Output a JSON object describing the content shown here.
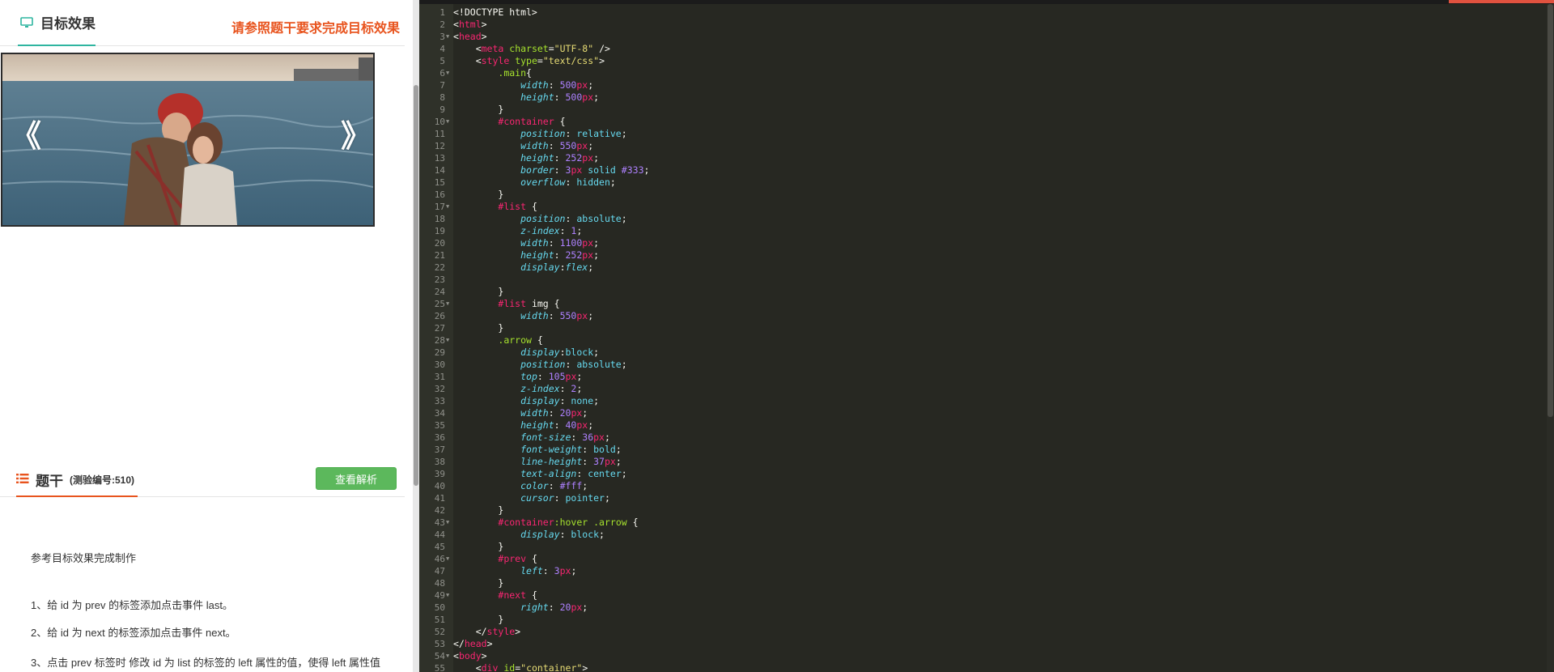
{
  "left": {
    "target_tab": "目标效果",
    "target_hint": "请参照题干要求完成目标效果",
    "arrow_prev": "《",
    "arrow_next": "》",
    "question_tab": "题干",
    "question_code": "(测验编号:510)",
    "analysis_button": "查看解析",
    "question_lines": [
      "参考目标效果完成制作",
      "1、给 id 为  prev 的标签添加点击事件 last。",
      "2、给 id 为  next 的标签添加点击事件 next。",
      "3、点击 prev 标签时 修改 id 为 list 的标签的 left 属性的值，使得 left 属性值"
    ]
  },
  "colors": {
    "accent_teal": "#2fb5a0",
    "accent_orange": "#e8541e",
    "button_green": "#5cb85c",
    "editor_bg": "#272822"
  },
  "editor": {
    "lines": [
      [
        [
          "plain",
          "<!DOCTYPE html>"
        ]
      ],
      [
        [
          "plain",
          "<"
        ],
        [
          "tag",
          "html"
        ],
        [
          "plain",
          ">"
        ]
      ],
      [
        [
          "plain",
          "<"
        ],
        [
          "tag",
          "head"
        ],
        [
          "plain",
          ">"
        ]
      ],
      [
        [
          "plain",
          "    <"
        ],
        [
          "tag",
          "meta"
        ],
        [
          "plain",
          " "
        ],
        [
          "attr",
          "charset"
        ],
        [
          "plain",
          "="
        ],
        [
          "str",
          "\"UTF-8\""
        ],
        [
          "plain",
          " />"
        ]
      ],
      [
        [
          "plain",
          "    <"
        ],
        [
          "tag",
          "style"
        ],
        [
          "plain",
          " "
        ],
        [
          "attr",
          "type"
        ],
        [
          "plain",
          "="
        ],
        [
          "str",
          "\"text/css\""
        ],
        [
          "plain",
          ">"
        ]
      ],
      [
        [
          "plain",
          "        "
        ],
        [
          "sel-class",
          ".main"
        ],
        [
          "plain",
          "{"
        ]
      ],
      [
        [
          "plain",
          "            "
        ],
        [
          "prop",
          "width"
        ],
        [
          "plain",
          ": "
        ],
        [
          "num",
          "500"
        ],
        [
          "unit",
          "px"
        ],
        [
          "plain",
          ";"
        ]
      ],
      [
        [
          "plain",
          "            "
        ],
        [
          "prop",
          "height"
        ],
        [
          "plain",
          ": "
        ],
        [
          "num",
          "500"
        ],
        [
          "unit",
          "px"
        ],
        [
          "plain",
          ";"
        ]
      ],
      [
        [
          "plain",
          "        }"
        ]
      ],
      [
        [
          "plain",
          "        "
        ],
        [
          "sel-id",
          "#container"
        ],
        [
          "plain",
          " {"
        ]
      ],
      [
        [
          "plain",
          "            "
        ],
        [
          "prop",
          "position"
        ],
        [
          "plain",
          ": "
        ],
        [
          "kw",
          "relative"
        ],
        [
          "plain",
          ";"
        ]
      ],
      [
        [
          "plain",
          "            "
        ],
        [
          "prop",
          "width"
        ],
        [
          "plain",
          ": "
        ],
        [
          "num",
          "550"
        ],
        [
          "unit",
          "px"
        ],
        [
          "plain",
          ";"
        ]
      ],
      [
        [
          "plain",
          "            "
        ],
        [
          "prop",
          "height"
        ],
        [
          "plain",
          ": "
        ],
        [
          "num",
          "252"
        ],
        [
          "unit",
          "px"
        ],
        [
          "plain",
          ";"
        ]
      ],
      [
        [
          "plain",
          "            "
        ],
        [
          "prop",
          "border"
        ],
        [
          "plain",
          ": "
        ],
        [
          "num",
          "3"
        ],
        [
          "unit",
          "px"
        ],
        [
          "plain",
          " "
        ],
        [
          "kw",
          "solid"
        ],
        [
          "plain",
          " "
        ],
        [
          "num",
          "#333"
        ],
        [
          "plain",
          ";"
        ]
      ],
      [
        [
          "plain",
          "            "
        ],
        [
          "prop",
          "overflow"
        ],
        [
          "plain",
          ": "
        ],
        [
          "kw",
          "hidden"
        ],
        [
          "plain",
          ";"
        ]
      ],
      [
        [
          "plain",
          "        }"
        ]
      ],
      [
        [
          "plain",
          "        "
        ],
        [
          "sel-id",
          "#list"
        ],
        [
          "plain",
          " {"
        ]
      ],
      [
        [
          "plain",
          "            "
        ],
        [
          "prop",
          "position"
        ],
        [
          "plain",
          ": "
        ],
        [
          "kw",
          "absolute"
        ],
        [
          "plain",
          ";"
        ]
      ],
      [
        [
          "plain",
          "            "
        ],
        [
          "prop",
          "z-index"
        ],
        [
          "plain",
          ": "
        ],
        [
          "num",
          "1"
        ],
        [
          "plain",
          ";"
        ]
      ],
      [
        [
          "plain",
          "            "
        ],
        [
          "prop",
          "width"
        ],
        [
          "plain",
          ": "
        ],
        [
          "num",
          "1100"
        ],
        [
          "unit",
          "px"
        ],
        [
          "plain",
          ";"
        ]
      ],
      [
        [
          "plain",
          "            "
        ],
        [
          "prop",
          "height"
        ],
        [
          "plain",
          ": "
        ],
        [
          "num",
          "252"
        ],
        [
          "unit",
          "px"
        ],
        [
          "plain",
          ";"
        ]
      ],
      [
        [
          "plain",
          "            "
        ],
        [
          "prop",
          "display"
        ],
        [
          "plain",
          ":"
        ],
        [
          "prop",
          "flex"
        ],
        [
          "plain",
          ";"
        ]
      ],
      [],
      [
        [
          "plain",
          "        }"
        ]
      ],
      [
        [
          "plain",
          "        "
        ],
        [
          "sel-id",
          "#list"
        ],
        [
          "plain",
          " img {"
        ]
      ],
      [
        [
          "plain",
          "            "
        ],
        [
          "prop",
          "width"
        ],
        [
          "plain",
          ": "
        ],
        [
          "num",
          "550"
        ],
        [
          "unit",
          "px"
        ],
        [
          "plain",
          ";"
        ]
      ],
      [
        [
          "plain",
          "        }"
        ]
      ],
      [
        [
          "plain",
          "        "
        ],
        [
          "sel-class",
          ".arrow"
        ],
        [
          "plain",
          " {"
        ]
      ],
      [
        [
          "plain",
          "            "
        ],
        [
          "prop",
          "display"
        ],
        [
          "plain",
          ":"
        ],
        [
          "kw",
          "block"
        ],
        [
          "plain",
          ";"
        ]
      ],
      [
        [
          "plain",
          "            "
        ],
        [
          "prop",
          "position"
        ],
        [
          "plain",
          ": "
        ],
        [
          "kw",
          "absolute"
        ],
        [
          "plain",
          ";"
        ]
      ],
      [
        [
          "plain",
          "            "
        ],
        [
          "prop",
          "top"
        ],
        [
          "plain",
          ": "
        ],
        [
          "num",
          "105"
        ],
        [
          "unit",
          "px"
        ],
        [
          "plain",
          ";"
        ]
      ],
      [
        [
          "plain",
          "            "
        ],
        [
          "prop",
          "z-index"
        ],
        [
          "plain",
          ": "
        ],
        [
          "num",
          "2"
        ],
        [
          "plain",
          ";"
        ]
      ],
      [
        [
          "plain",
          "            "
        ],
        [
          "prop",
          "display"
        ],
        [
          "plain",
          ": "
        ],
        [
          "kw",
          "none"
        ],
        [
          "plain",
          ";"
        ]
      ],
      [
        [
          "plain",
          "            "
        ],
        [
          "prop",
          "width"
        ],
        [
          "plain",
          ": "
        ],
        [
          "num",
          "20"
        ],
        [
          "unit",
          "px"
        ],
        [
          "plain",
          ";"
        ]
      ],
      [
        [
          "plain",
          "            "
        ],
        [
          "prop",
          "height"
        ],
        [
          "plain",
          ": "
        ],
        [
          "num",
          "40"
        ],
        [
          "unit",
          "px"
        ],
        [
          "plain",
          ";"
        ]
      ],
      [
        [
          "plain",
          "            "
        ],
        [
          "prop",
          "font-size"
        ],
        [
          "plain",
          ": "
        ],
        [
          "num",
          "36"
        ],
        [
          "unit",
          "px"
        ],
        [
          "plain",
          ";"
        ]
      ],
      [
        [
          "plain",
          "            "
        ],
        [
          "prop",
          "font-weight"
        ],
        [
          "plain",
          ": "
        ],
        [
          "kw",
          "bold"
        ],
        [
          "plain",
          ";"
        ]
      ],
      [
        [
          "plain",
          "            "
        ],
        [
          "prop",
          "line-height"
        ],
        [
          "plain",
          ": "
        ],
        [
          "num",
          "37"
        ],
        [
          "unit",
          "px"
        ],
        [
          "plain",
          ";"
        ]
      ],
      [
        [
          "plain",
          "            "
        ],
        [
          "prop",
          "text-align"
        ],
        [
          "plain",
          ": "
        ],
        [
          "kw",
          "center"
        ],
        [
          "plain",
          ";"
        ]
      ],
      [
        [
          "plain",
          "            "
        ],
        [
          "prop",
          "color"
        ],
        [
          "plain",
          ": "
        ],
        [
          "num",
          "#fff"
        ],
        [
          "plain",
          ";"
        ]
      ],
      [
        [
          "plain",
          "            "
        ],
        [
          "prop",
          "cursor"
        ],
        [
          "plain",
          ": "
        ],
        [
          "kw",
          "pointer"
        ],
        [
          "plain",
          ";"
        ]
      ],
      [
        [
          "plain",
          "        }"
        ]
      ],
      [
        [
          "plain",
          "        "
        ],
        [
          "sel-id",
          "#container"
        ],
        [
          "sel-class",
          ":hover"
        ],
        [
          "plain",
          " "
        ],
        [
          "sel-class",
          ".arrow"
        ],
        [
          "plain",
          " {"
        ]
      ],
      [
        [
          "plain",
          "            "
        ],
        [
          "prop",
          "display"
        ],
        [
          "plain",
          ": "
        ],
        [
          "kw",
          "block"
        ],
        [
          "plain",
          ";"
        ]
      ],
      [
        [
          "plain",
          "        }"
        ]
      ],
      [
        [
          "plain",
          "        "
        ],
        [
          "sel-id",
          "#prev"
        ],
        [
          "plain",
          " {"
        ]
      ],
      [
        [
          "plain",
          "            "
        ],
        [
          "prop",
          "left"
        ],
        [
          "plain",
          ": "
        ],
        [
          "num",
          "3"
        ],
        [
          "unit",
          "px"
        ],
        [
          "plain",
          ";"
        ]
      ],
      [
        [
          "plain",
          "        }"
        ]
      ],
      [
        [
          "plain",
          "        "
        ],
        [
          "sel-id",
          "#next"
        ],
        [
          "plain",
          " {"
        ]
      ],
      [
        [
          "plain",
          "            "
        ],
        [
          "prop",
          "right"
        ],
        [
          "plain",
          ": "
        ],
        [
          "num",
          "20"
        ],
        [
          "unit",
          "px"
        ],
        [
          "plain",
          ";"
        ]
      ],
      [
        [
          "plain",
          "        }"
        ]
      ],
      [
        [
          "plain",
          "    </"
        ],
        [
          "tag",
          "style"
        ],
        [
          "plain",
          ">"
        ]
      ],
      [
        [
          "plain",
          "</"
        ],
        [
          "tag",
          "head"
        ],
        [
          "plain",
          ">"
        ]
      ],
      [
        [
          "plain",
          "<"
        ],
        [
          "tag",
          "body"
        ],
        [
          "plain",
          ">"
        ]
      ],
      [
        [
          "plain",
          "    <"
        ],
        [
          "tag",
          "div"
        ],
        [
          "plain",
          " "
        ],
        [
          "attr",
          "id"
        ],
        [
          "plain",
          "="
        ],
        [
          "str",
          "\"container\""
        ],
        [
          "plain",
          ">"
        ]
      ]
    ],
    "fold_lines": [
      3,
      6,
      10,
      17,
      25,
      28,
      43,
      46,
      49,
      54
    ]
  }
}
